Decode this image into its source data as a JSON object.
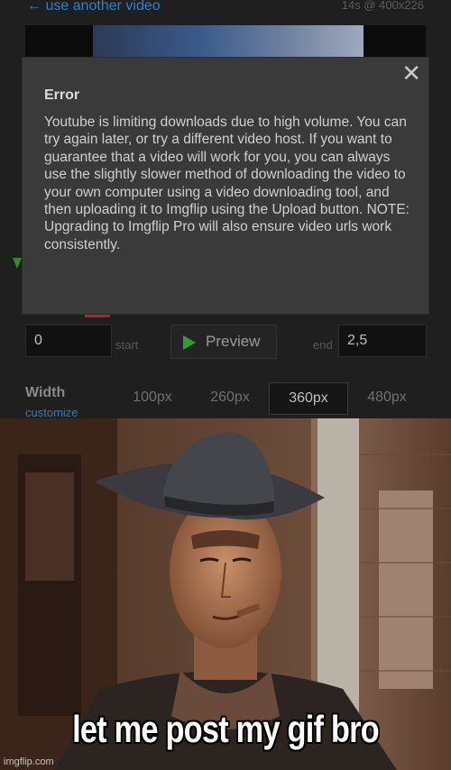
{
  "editor": {
    "back_link": "← use another video",
    "video_meta": "14s @ 400x226",
    "modal": {
      "close_glyph": "✕",
      "title": "Error",
      "body": "Youtube is limiting downloads due to high volume. You can try again later, or try a different video host. If you want to guarantee that a video will work for you, you can always use the slightly slower method of downloading the video to your own computer using a video downloading tool, and then uploading it to Imgflip using the Upload button. NOTE: Upgrading to Imgflip Pro will also ensure video urls work consistently."
    },
    "trim": {
      "start_value": "0",
      "start_label": "start",
      "preview_label": "Preview",
      "end_label": "end",
      "end_value": "2,5"
    },
    "width": {
      "label": "Width",
      "customize_link": "customize",
      "options": [
        "100px",
        "260px",
        "360px",
        "480px"
      ],
      "selected": "360px"
    },
    "colors": {
      "link": "#2f7fd0",
      "play": "#2fa02f"
    }
  },
  "meme": {
    "caption": "let me post my gif bro",
    "watermark": "imgflip.com"
  }
}
